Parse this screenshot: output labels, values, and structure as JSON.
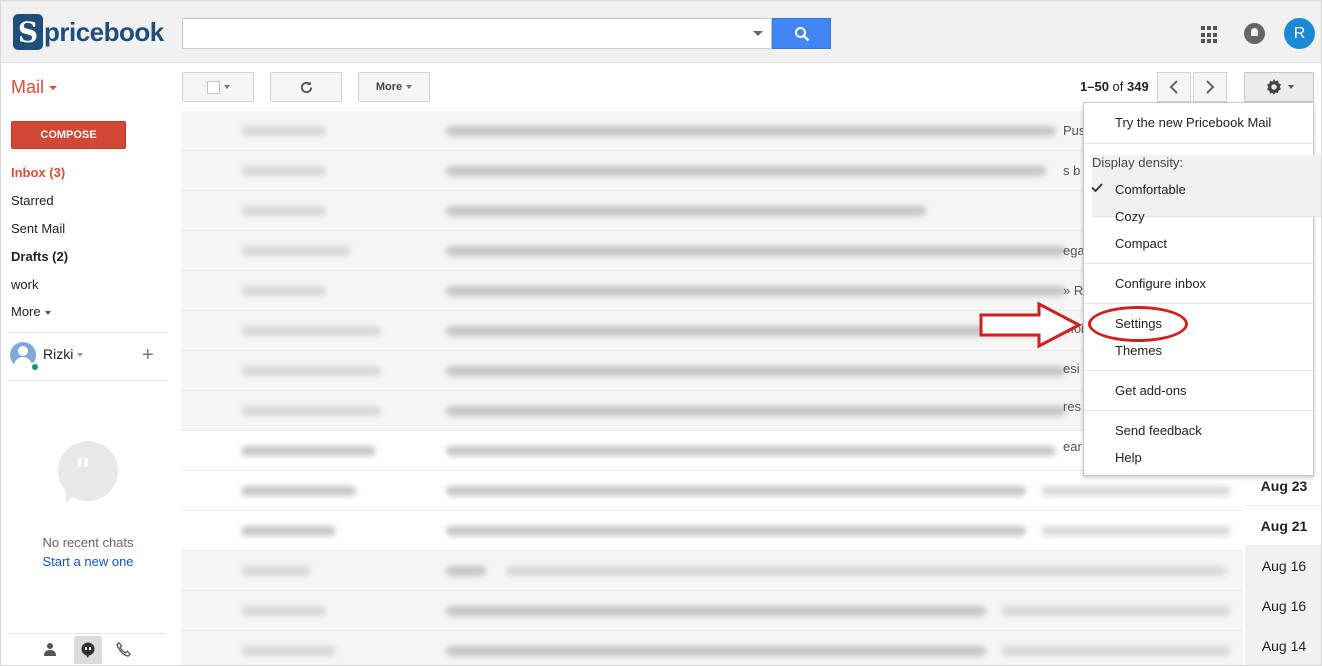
{
  "header": {
    "logo_initial": "S",
    "logo_text": "pricebook",
    "avatar_letter": "R"
  },
  "toolbar": {
    "mail_label": "Mail",
    "more_label": "More",
    "page_count_range": "1–50",
    "page_count_of": "of",
    "page_count_total": "349"
  },
  "sidebar": {
    "compose_label": "COMPOSE",
    "items": [
      {
        "label": "Inbox (3)"
      },
      {
        "label": "Starred"
      },
      {
        "label": "Sent Mail"
      },
      {
        "label": "Drafts (2)"
      },
      {
        "label": "work"
      },
      {
        "label": "More"
      }
    ],
    "user_name": "Rizki",
    "no_chats": "No recent chats",
    "start_new": "Start a new one"
  },
  "email_dates": [
    "Aug 23",
    "Aug 21",
    "Aug 16",
    "Aug 16",
    "Aug 14"
  ],
  "settings_menu": {
    "try_new": "Try the new Pricebook Mail",
    "density_header": "Display density:",
    "comfortable": "Comfortable",
    "cozy": "Cozy",
    "compact": "Compact",
    "configure_inbox": "Configure inbox",
    "settings": "Settings",
    "themes": "Themes",
    "get_addons": "Get add-ons",
    "send_feedback": "Send feedback",
    "help": "Help"
  },
  "colors": {
    "accent_red": "#dd4b39",
    "compose_red": "#d14836",
    "search_blue": "#4285f4",
    "brand_blue": "#1f4e7a",
    "annotation_red": "#d01f1f"
  }
}
